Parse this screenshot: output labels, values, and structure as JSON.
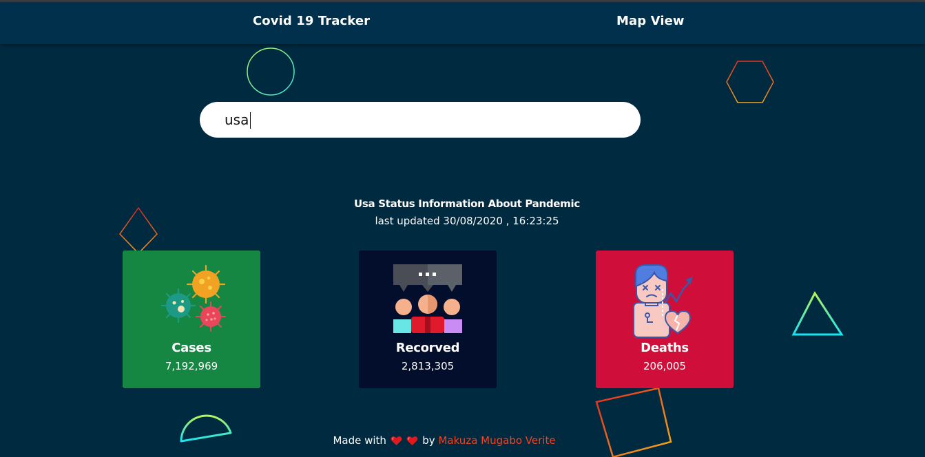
{
  "nav": {
    "tracker_label": "Covid 19 Tracker",
    "map_label": "Map View"
  },
  "search": {
    "value": "usa",
    "placeholder": ""
  },
  "status": {
    "title": "Usa Status Information About Pandemic",
    "updated_label": "last updated",
    "updated_value": "30/08/2020 , 16:23:25"
  },
  "cards": [
    {
      "label": "Cases",
      "value": "7,192,969",
      "color": "#168643",
      "icon": "virus-icon"
    },
    {
      "label": "Recorved",
      "value": "2,813,305",
      "color": "#030d2c",
      "icon": "people-chat-icon"
    },
    {
      "label": "Deaths",
      "value": "206,005",
      "color": "#cf0f3a",
      "icon": "sick-person-icon"
    }
  ],
  "footer": {
    "made_with": "Made with",
    "by": "by",
    "author": "Makuza Mugabo Verite",
    "heart_color": "#e0191f",
    "author_color": "#f5431d"
  }
}
